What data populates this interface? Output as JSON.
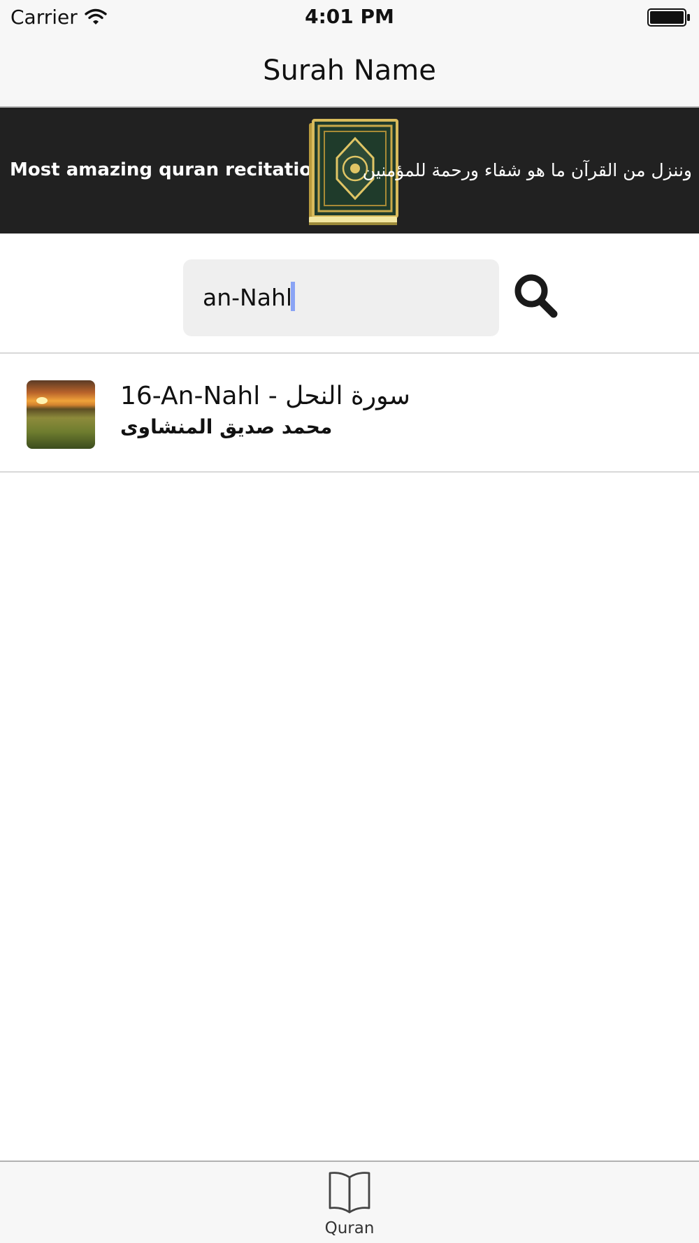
{
  "status_bar": {
    "carrier": "Carrier",
    "time": "4:01 PM",
    "icons": [
      "wifi-icon",
      "battery-icon"
    ]
  },
  "nav": {
    "title": "Surah Name"
  },
  "banner": {
    "left_text": "Most amazing quran recitation",
    "right_text": "وننزل من القرآن ما هو شفاء  ورحمة للمؤمنين",
    "image_icon": "quran-book-icon",
    "background_color": "#212121"
  },
  "search": {
    "value": "an-Nahl",
    "button_icon": "search-icon"
  },
  "results": [
    {
      "title": "16-An-Nahl - سورة النحل",
      "reciter": "محمد صديق المنشاوى",
      "thumbnail": "sunset-field-thumbnail"
    }
  ],
  "tab_bar": {
    "tabs": [
      {
        "label": "Quran",
        "icon": "book-icon",
        "selected": true
      }
    ]
  }
}
